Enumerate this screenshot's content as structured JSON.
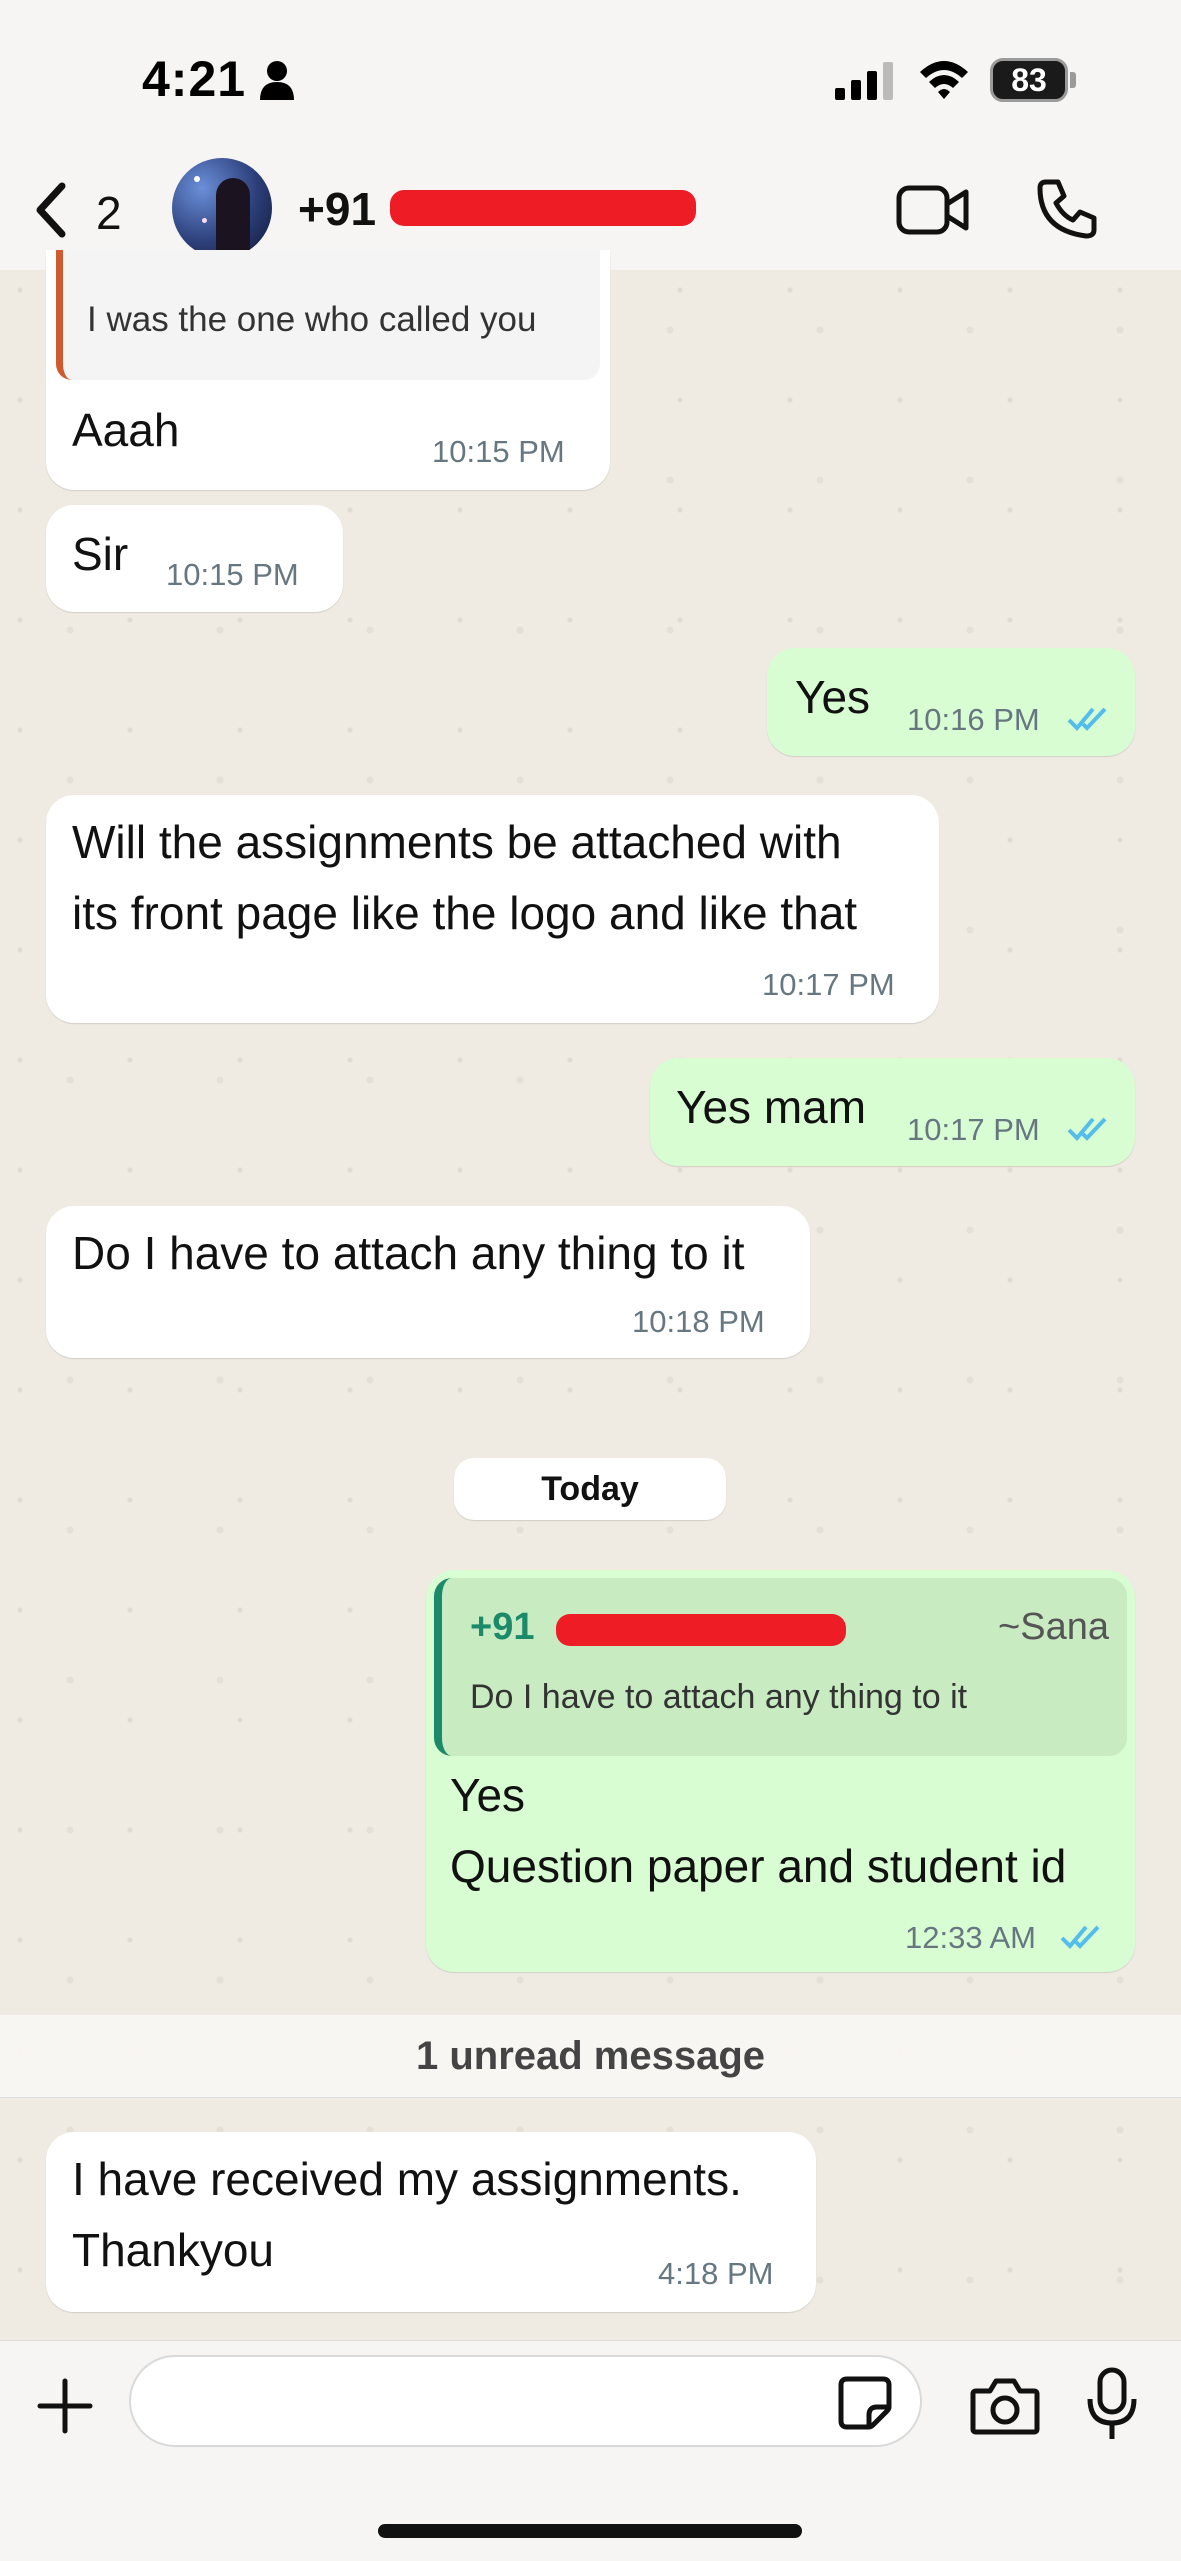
{
  "status": {
    "time": "4:21",
    "battery": "83"
  },
  "header": {
    "back_count": "2",
    "contact_prefix": "+91"
  },
  "messages": [
    {
      "quote": "I was the one who called you",
      "text": "Aaah",
      "time": "10:15 PM"
    },
    {
      "text": "Sir",
      "time": "10:15 PM"
    },
    {
      "text": "Yes",
      "time": "10:16 PM"
    },
    {
      "text": "Will the assignments be attached with\nits front page like the logo and like that",
      "time": "10:17 PM"
    },
    {
      "text": "Yes mam",
      "time": "10:17 PM"
    },
    {
      "text": "Do I have to attach any thing to it",
      "time": "10:18 PM"
    },
    {
      "quote_sender": "+91",
      "quote_name": "~Sana",
      "quote": "Do I have to attach any thing to it",
      "text": "Yes\nQuestion paper and student id",
      "time": "12:33 AM"
    },
    {
      "text": "I have received my assignments.\nThankyou",
      "time": "4:18 PM"
    }
  ],
  "date_separator": "Today",
  "unread_label": "1 unread message",
  "colors": {
    "outgoing": "#d9fdd3",
    "incoming": "#ffffff",
    "tick_blue": "#53bdeb",
    "quote_green": "#1b8a6b",
    "quote_orange": "#d05a2e"
  }
}
